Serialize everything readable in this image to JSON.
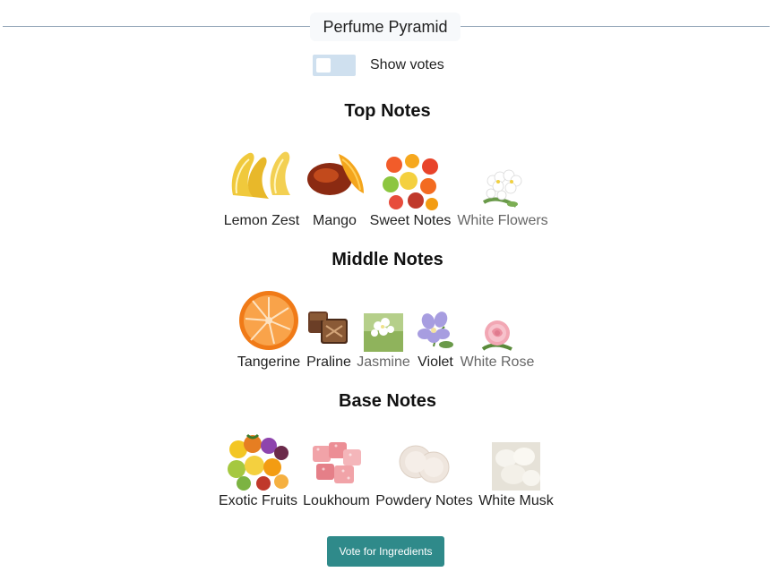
{
  "header": {
    "title": "Perfume Pyramid"
  },
  "toggle": {
    "label": "Show votes",
    "on": false
  },
  "sections": {
    "top": {
      "title": "Top Notes",
      "items": [
        {
          "label": "Lemon Zest",
          "icon": "lemon-zest-image"
        },
        {
          "label": "Mango",
          "icon": "mango-image"
        },
        {
          "label": "Sweet Notes",
          "icon": "sweet-notes-image"
        },
        {
          "label": "White Flowers",
          "icon": "white-flowers-image"
        }
      ]
    },
    "middle": {
      "title": "Middle Notes",
      "items": [
        {
          "label": "Tangerine",
          "icon": "tangerine-image"
        },
        {
          "label": "Praline",
          "icon": "praline-image"
        },
        {
          "label": "Jasmine",
          "icon": "jasmine-image"
        },
        {
          "label": "Violet",
          "icon": "violet-image"
        },
        {
          "label": "White Rose",
          "icon": "white-rose-image"
        }
      ]
    },
    "base": {
      "title": "Base Notes",
      "items": [
        {
          "label": "Exotic Fruits",
          "icon": "exotic-fruits-image"
        },
        {
          "label": "Loukhoum",
          "icon": "loukhoum-image"
        },
        {
          "label": "Powdery Notes",
          "icon": "powdery-notes-image"
        },
        {
          "label": "White Musk",
          "icon": "white-musk-image"
        }
      ]
    }
  },
  "vote_button": {
    "label": "Vote for Ingredients"
  },
  "colors": {
    "accent": "#2f8a8a",
    "toggle_track": "#cfe0ef",
    "divider": "#8fa2b5"
  }
}
